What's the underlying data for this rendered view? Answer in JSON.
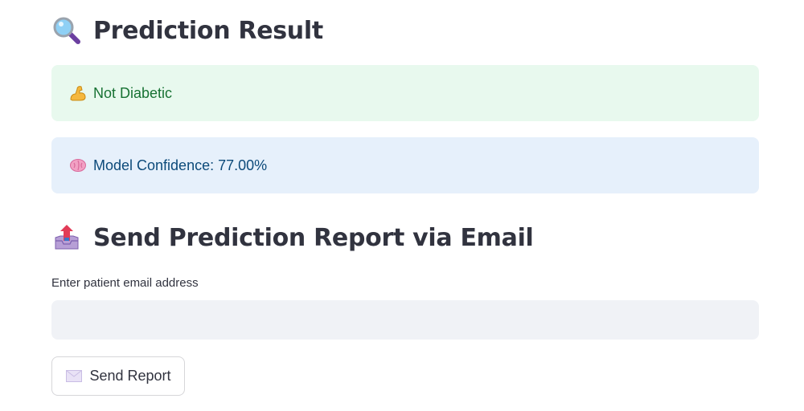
{
  "result_section": {
    "title": "Prediction Result",
    "title_icon": "magnifying-glass-icon",
    "prediction": {
      "icon": "flexed-biceps-icon",
      "text": "Not Diabetic",
      "status_color": "#177233",
      "background": "#e8f9ee"
    },
    "confidence": {
      "icon": "brain-icon",
      "text": "Model Confidence: 77.00%",
      "text_color": "#0c4a7a",
      "background": "#e6f0fb"
    }
  },
  "email_section": {
    "title": "Send Prediction Report via Email",
    "title_icon": "outbox-tray-icon",
    "email_field": {
      "label": "Enter patient email address",
      "value": "",
      "placeholder": ""
    },
    "send_button": {
      "icon": "envelope-icon",
      "label": "Send Report"
    }
  }
}
